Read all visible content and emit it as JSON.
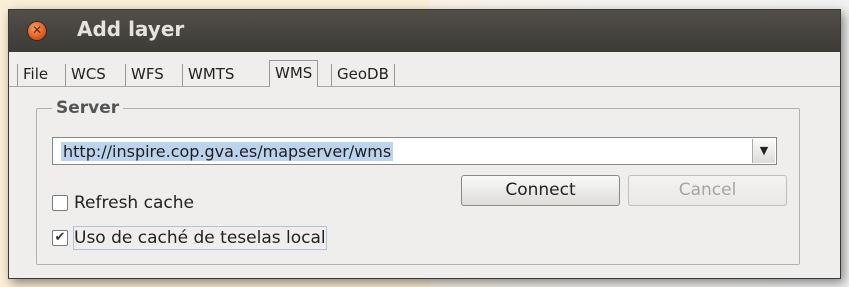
{
  "window": {
    "title": "Add layer"
  },
  "tabs": [
    {
      "label": "File"
    },
    {
      "label": "WCS"
    },
    {
      "label": "WFS"
    },
    {
      "label": "WMTS"
    },
    {
      "label": "WMS",
      "active": true
    },
    {
      "label": "GeoDB"
    }
  ],
  "server": {
    "group_label": "Server",
    "url_value": "http://inspire.cop.gva.es/mapserver/wms",
    "refresh_cache_label": "Refresh cache",
    "refresh_cache_checked": false,
    "local_tile_cache_label": "Uso de caché de teselas local",
    "local_tile_cache_checked": true,
    "connect_label": "Connect",
    "cancel_label": "Cancel"
  },
  "icons": {
    "close": "close-icon",
    "dropdown": "chevron-down-icon",
    "check": "checkmark-icon"
  },
  "colors": {
    "titlebar": "#3d3b37",
    "close_button": "#e25a1f",
    "dialog_bg": "#efeeed",
    "selection": "#bcd3ee"
  }
}
